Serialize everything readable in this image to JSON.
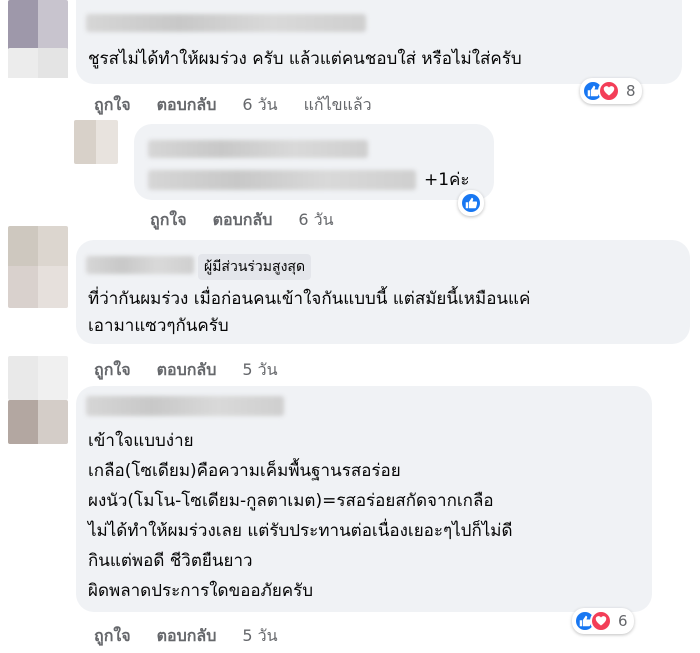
{
  "comments": [
    {
      "body_lines": [
        "ชูรสไม่ได้ทำให้ผมร่วง ครับ แล้วแต่คนชอบใส่ หรือไม่ใส่ครับ"
      ],
      "actions": {
        "like": "ถูกใจ",
        "reply": "ตอบกลับ",
        "time": "6 วัน",
        "edited": "แก้ไขแล้ว"
      },
      "reaction_count": "8"
    },
    {
      "body_suffix": "+1ค่ะ",
      "actions": {
        "like": "ถูกใจ",
        "reply": "ตอบกลับ",
        "time": "6 วัน"
      }
    },
    {
      "badge": "ผู้มีส่วนร่วมสูงสุด",
      "body_lines": [
        "ที่ว่ากันผมร่วง เมื่อก่อนคนเข้าใจกันแบบนี้ แต่สมัยนี้เหมือนแค่",
        "เอามาแซวๆกันครับ"
      ],
      "actions": {
        "like": "ถูกใจ",
        "reply": "ตอบกลับ",
        "time": "5 วัน"
      }
    },
    {
      "body_lines": [
        "เข้าใจแบบง่าย",
        "เกลือ(โซเดียม)คือความเค็มพื้นฐานรสอร่อย",
        "ผงนัว(โมโน-โซเดียม-กูลตาเมต)=รสอร่อยสกัดจากเกลือ",
        "ไม่ได้ทำให้ผมร่วงเลย แต่รับประทานต่อเนื่องเยอะๆไปก็ไม่ดี",
        "กินแต่พอดี ชีวิตยืนยาว",
        "ผิดพลาดประการใดขออภัยครับ"
      ],
      "actions": {
        "like": "ถูกใจ",
        "reply": "ตอบกลับ",
        "time": "5 วัน"
      },
      "reaction_count": "6"
    }
  ],
  "icons": [
    "like-icon",
    "love-icon"
  ],
  "colors": {
    "bubble": "#f0f2f5",
    "like": "#1877f2",
    "love": "#f33e58",
    "meta": "#65676b"
  }
}
